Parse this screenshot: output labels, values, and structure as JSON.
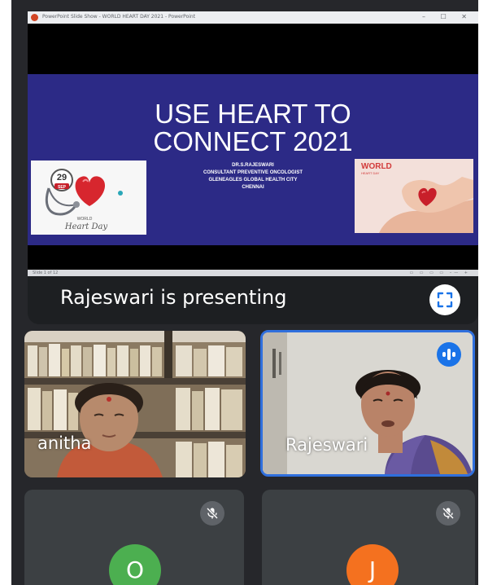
{
  "share_window": {
    "title_bar_text": "PowerPoint Slide Show - WORLD HEART DAY 2021 - PowerPoint",
    "window_controls": "– ☐ ✕",
    "status_bar_text": "Slide 1 of 12",
    "status_bar_controls": "▭ ▭ ▭ ▭ –— +"
  },
  "slide": {
    "title_line1": "USE HEART TO",
    "title_line2": "CONNECT 2021",
    "credit_name": "DR.S.RAJESWARI",
    "credit_role": "CONSULTANT PREVENTIVE ONCOLOGIST",
    "credit_org": "GLENEAGLES GLOBAL HEALTH CITY",
    "credit_city": "CHENNAI",
    "left_image": {
      "date_day": "29",
      "date_month": "SEP",
      "caption_small": "WORLD",
      "caption_script": "Heart Day"
    },
    "right_image": {
      "logo_line1": "WORLD",
      "logo_line2": "HEART DAY"
    },
    "background_color": "#2c2a86"
  },
  "presenting": {
    "label": "Rajeswari is presenting",
    "fullscreen_icon": "fullscreen-icon"
  },
  "participants": [
    {
      "name": "anitha",
      "has_video": true,
      "speaking": false
    },
    {
      "name": "Rajeswari",
      "has_video": true,
      "speaking": true,
      "highlight_color": "#2f6fdd"
    },
    {
      "name": "",
      "initial": "O",
      "avatar_color": "#4caf50",
      "muted": true
    },
    {
      "name": "",
      "initial": "J",
      "avatar_color": "#f4711f",
      "muted": true
    }
  ]
}
